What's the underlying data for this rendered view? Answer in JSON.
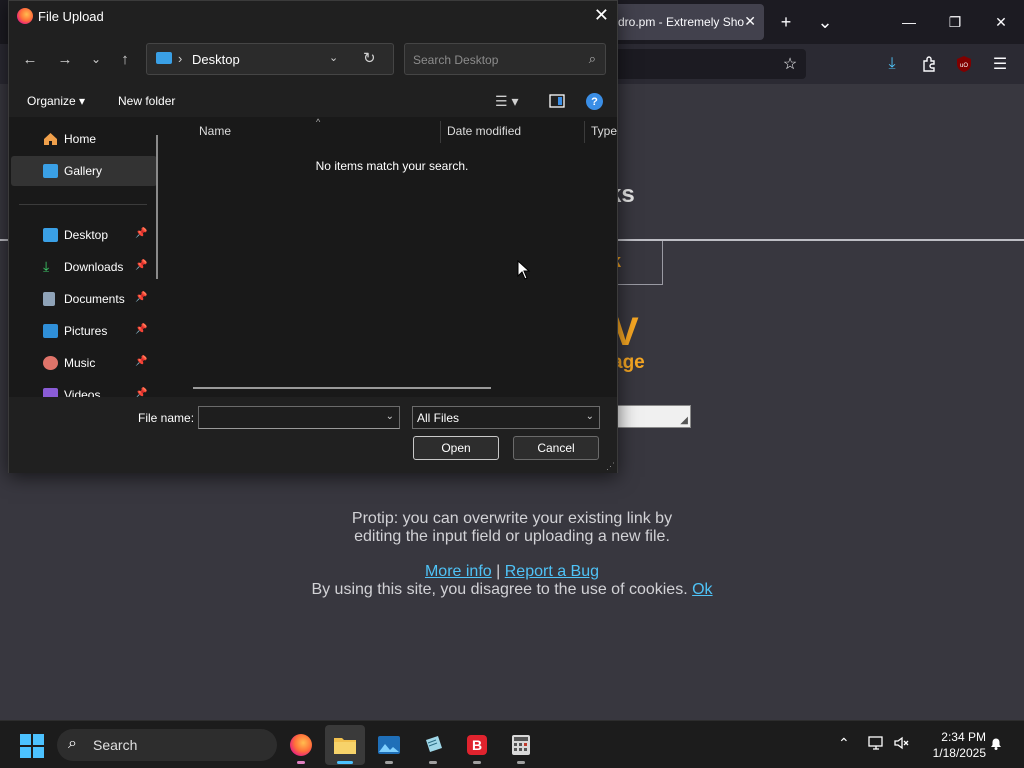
{
  "browser": {
    "tab_title": "dro.pm - Extremely Sho",
    "tab_close": "✕",
    "new_tab": "+",
    "tab_list": "⌄",
    "minimize": "—",
    "restore": "❐",
    "close": "✕"
  },
  "page": {
    "heading_fragment": "ks",
    "link_fragment": "nk",
    "big_fragment": "V",
    "sub_fragment": "age",
    "protip_line1": "Protip: you can overwrite your existing link by",
    "protip_line2": "editing the input field or uploading a new file.",
    "more_info": "More info",
    "pipe": "|",
    "report_bug": "Report a Bug",
    "cookie_text": "By using this site, you disagree to the use of cookies.",
    "cookie_ok": "Ok",
    "colors": {
      "accent": "#f5a623",
      "link": "#4fc3f7"
    }
  },
  "dialog": {
    "title": "File Upload",
    "close": "✕",
    "address": {
      "crumb": "Desktop",
      "separator": "›"
    },
    "search_placeholder": "Search Desktop",
    "organize": "Organize ▾",
    "new_folder": "New folder",
    "help": "?",
    "sidebar": [
      {
        "label": "Home",
        "icon": "home-icon",
        "pinned": false,
        "selected": false
      },
      {
        "label": "Gallery",
        "icon": "gallery-icon",
        "pinned": false,
        "selected": true
      },
      {
        "label": "Desktop",
        "icon": "desktop-icon",
        "pinned": true,
        "selected": false
      },
      {
        "label": "Downloads",
        "icon": "downloads-icon",
        "pinned": true,
        "selected": false
      },
      {
        "label": "Documents",
        "icon": "documents-icon",
        "pinned": true,
        "selected": false
      },
      {
        "label": "Pictures",
        "icon": "pictures-icon",
        "pinned": true,
        "selected": false
      },
      {
        "label": "Music",
        "icon": "music-icon",
        "pinned": true,
        "selected": false
      },
      {
        "label": "Videos",
        "icon": "videos-icon",
        "pinned": true,
        "selected": false
      }
    ],
    "columns": {
      "name": "Name",
      "date_modified": "Date modified",
      "type": "Type"
    },
    "empty_message": "No items match your search.",
    "file_name_label": "File name:",
    "file_name_value": "",
    "file_type": "All Files",
    "open_button": "Open",
    "cancel_button": "Cancel"
  },
  "taskbar": {
    "search_label": "Search",
    "time": "2:34 PM",
    "date": "1/18/2025",
    "apps": [
      "firefox-icon",
      "file-explorer-icon",
      "photos-icon",
      "notepad-icon",
      "brave-icon",
      "calculator-icon"
    ]
  }
}
